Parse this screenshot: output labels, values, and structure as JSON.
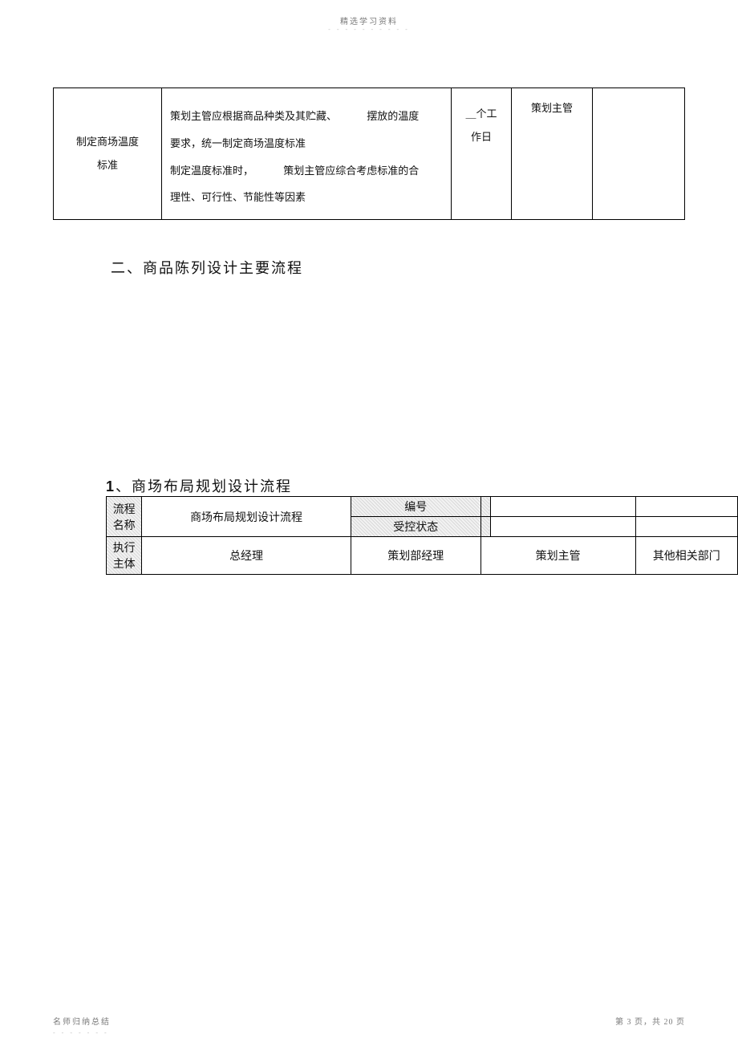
{
  "header": {
    "label": "精选学习资料",
    "dashes": "- - - - - - - - - -"
  },
  "table1": {
    "left_line1": "制定商场温度",
    "left_line2": "标准",
    "para1_a": "策划主管应根据商品种类及其贮藏、",
    "para1_b": "摆放的温度",
    "para2": "要求，统一制定商场温度标准",
    "para3_a": "制定温度标准时，",
    "para3_b": "策划主管应综合考虑标准的合",
    "para4": "理性、可行性、节能性等因素",
    "time_line1": "＿个工",
    "time_line2": "作日",
    "responsible": "策划主管"
  },
  "heading_section2": "二、商品陈列设计主要流程",
  "heading_sub": {
    "num": "1",
    "sep": "、",
    "text": "商场布局规划设计流程"
  },
  "table2": {
    "row_label_1a": "流程",
    "row_label_1b": "名称",
    "name_value": "商场布局规划设计流程",
    "code_label": "编号",
    "state_label": "受控状态",
    "row_label_2a": "执行",
    "row_label_2b": "主体",
    "party1": "总经理",
    "party2": "策划部经理",
    "party3": "策划主管",
    "party4": "其他相关部门"
  },
  "footer": {
    "left": "名师归纳总结",
    "left_dashes": "- - - - - - -",
    "right": "第 3 页，共 20 页"
  }
}
